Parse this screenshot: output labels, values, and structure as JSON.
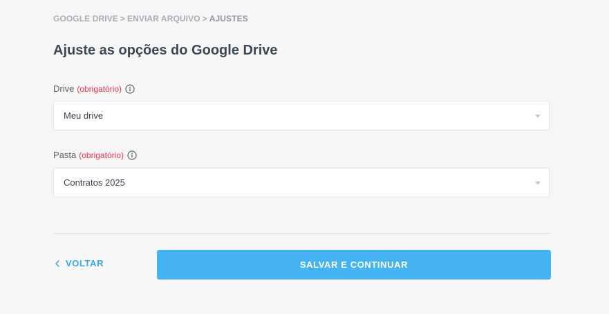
{
  "breadcrumb": {
    "items": [
      "GOOGLE DRIVE",
      "ENVIAR ARQUIVO",
      "AJUSTES"
    ],
    "separator": ">"
  },
  "page_title": "Ajuste as opções do Google Drive",
  "fields": [
    {
      "label": "Drive",
      "required_text": "(obrigatório)",
      "icon": "info-icon",
      "value": "Meu drive"
    },
    {
      "label": "Pasta",
      "required_text": "(obrigatório)",
      "icon": "info-icon",
      "value": "Contratos 2025"
    }
  ],
  "footer": {
    "back_label": "VOLTAR",
    "back_icon": "chevron-left-icon",
    "submit_label": "SALVAR E CONTINUAR"
  },
  "colors": {
    "accent": "#45b3f2",
    "link": "#3aa8e8",
    "required": "#e0344e",
    "background": "#f6f6f6"
  }
}
